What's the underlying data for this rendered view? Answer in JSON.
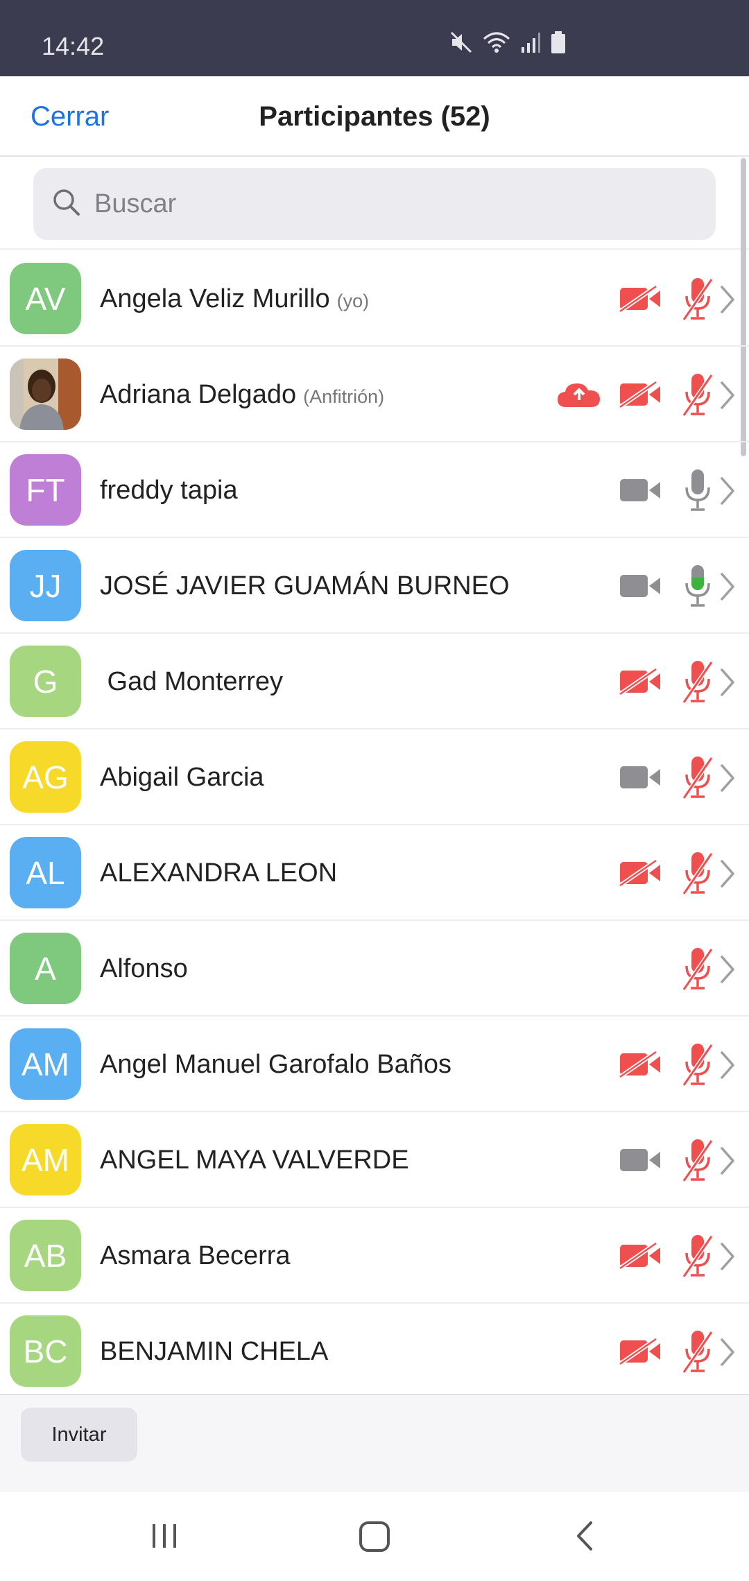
{
  "status_bar": {
    "time": "14:42"
  },
  "header": {
    "close_label": "Cerrar",
    "title": "Participantes (52)"
  },
  "search": {
    "placeholder": "Buscar"
  },
  "colors": {
    "accent": "#1a73e8",
    "muted_red": "#f04f4f",
    "icon_gray": "#8e8e93",
    "speaking_green": "#3db33d"
  },
  "participants": [
    {
      "initials": "AV",
      "avatar_color": "#7fc97f",
      "name": "Angela Veliz Murillo",
      "role": "(yo)",
      "video": "off",
      "audio": "muted",
      "cloud": false
    },
    {
      "initials": "",
      "avatar_color": "#8a6a50",
      "avatar_photo": true,
      "name": "Adriana Delgado",
      "role": "(Anfitrión)",
      "video": "off",
      "audio": "muted",
      "cloud": true
    },
    {
      "initials": "FT",
      "avatar_color": "#c07fd6",
      "name": "freddy tapia",
      "role": "",
      "video": "on",
      "audio": "unmuted",
      "cloud": false
    },
    {
      "initials": "JJ",
      "avatar_color": "#5aaef2",
      "name": "JOSÉ JAVIER GUAMÁN BURNEO",
      "role": "",
      "video": "on",
      "audio": "speaking",
      "cloud": false
    },
    {
      "initials": "G",
      "avatar_color": "#a6d67f",
      "name": " Gad Monterrey",
      "role": "",
      "video": "off",
      "audio": "muted",
      "cloud": false
    },
    {
      "initials": "AG",
      "avatar_color": "#f7d92a",
      "name": "Abigail Garcia",
      "role": "",
      "video": "on",
      "audio": "muted",
      "cloud": false
    },
    {
      "initials": "AL",
      "avatar_color": "#5aaef2",
      "name": "ALEXANDRA LEON",
      "role": "",
      "video": "off",
      "audio": "muted",
      "cloud": false
    },
    {
      "initials": "A",
      "avatar_color": "#7fc97f",
      "name": "Alfonso",
      "role": "",
      "video": "none",
      "audio": "muted",
      "cloud": false
    },
    {
      "initials": "AM",
      "avatar_color": "#5aaef2",
      "name": "Angel Manuel Garofalo Baños",
      "role": "",
      "video": "off",
      "audio": "muted",
      "cloud": false
    },
    {
      "initials": "AM",
      "avatar_color": "#f7d92a",
      "name": "ANGEL MAYA VALVERDE",
      "role": "",
      "video": "on",
      "audio": "muted",
      "cloud": false
    },
    {
      "initials": "AB",
      "avatar_color": "#a6d67f",
      "name": "Asmara Becerra",
      "role": "",
      "video": "off",
      "audio": "muted",
      "cloud": false
    },
    {
      "initials": "BC",
      "avatar_color": "#a6d67f",
      "name": "BENJAMIN CHELA",
      "role": "",
      "video": "off",
      "audio": "muted",
      "cloud": false
    }
  ],
  "footer": {
    "invite_label": "Invitar"
  }
}
